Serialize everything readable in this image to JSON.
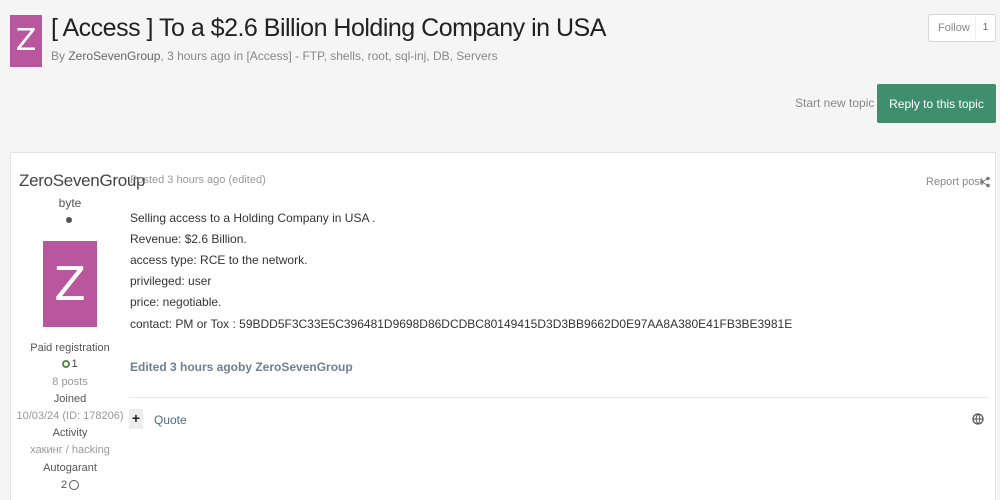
{
  "topic": {
    "avatar_letter": "Z",
    "title": "[ Access ] To a $2.6 Billion Holding Company in USA",
    "meta_prefix": "By ",
    "author": "ZeroSevenGroup",
    "meta_rest": ", 3 hours ago in [Access] - FTP, shells, root, sql-inj, DB, Servers"
  },
  "follow": {
    "label": "Follow",
    "count": "1"
  },
  "actions": {
    "start_topic": "Start new topic",
    "reply": "Reply to this topic"
  },
  "post": {
    "author": {
      "name": "ZeroSevenGroup",
      "rank": "byte",
      "avatar_letter": "Z",
      "group": "Paid registration",
      "reputation": "1",
      "posts": "8 posts",
      "joined_label": "Joined",
      "joined_value": "10/03/24 (ID: 178206)",
      "activity_label": "Activity",
      "activity_value": "хакинг / hacking",
      "autogarant_label": "Autogarant",
      "autogarant_value": "2"
    },
    "posted": "Posted 3 hours ago (edited)",
    "report": "Report post",
    "lines": [
      "Selling access to a Holding Company in USA .",
      "Revenue: $2.6 Billion.",
      "access type: RCE to the network.",
      "privileged: user",
      "price: negotiable.",
      "contact: PM or Tox : 59BDD5F3C33E5C396481D9698D86DCDBC80149415D3D3BB9662D0E97AA8A380E41FB3BE3981E"
    ],
    "edited": "Edited 3 hours agoby ZeroSevenGroup",
    "plus": "+",
    "quote": "Quote"
  },
  "colors": {
    "avatar": "#b8579e",
    "reply_button": "#3f8f6e"
  },
  "icons": [
    "share-icon",
    "globe-icon",
    "reputation-icon",
    "garant-icon"
  ]
}
